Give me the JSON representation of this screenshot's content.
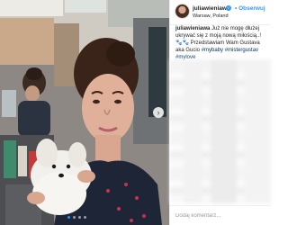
{
  "post": {
    "username": "juliawieniawa",
    "verified": true,
    "follow_label": "• Obserwuj",
    "location": "Warsaw, Poland",
    "caption": {
      "user": "juliawieniawa",
      "text": "Już nie mogę dłużej ukrywać się z moją nową miłością..! 🐾🐾 Przedstawiam Wam Gustava aka Gucio",
      "hashtags": "#mybaby #mistergustav #mylove"
    },
    "comment_placeholder": "Dodaj komentarz..."
  },
  "carousel": {
    "next_icon": "›",
    "slide_count": 4,
    "active_index": 0
  },
  "colors": {
    "link": "#3897f0",
    "hashtag": "#003569",
    "text": "#262626",
    "muted": "#999999"
  },
  "icons": [
    "chevron-right-icon",
    "verified-badge-icon"
  ]
}
